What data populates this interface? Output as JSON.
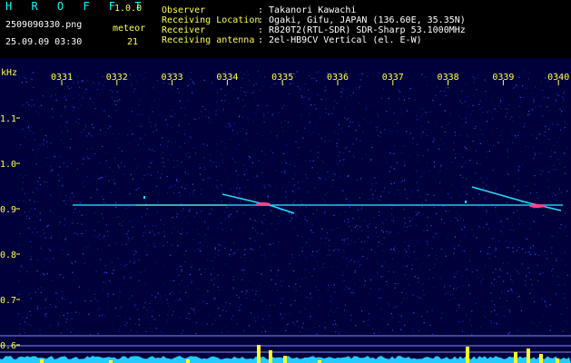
{
  "header": {
    "app_name": "H R O F F T",
    "version": "1.0.0",
    "filename": "2509090330.png",
    "meteor_label": "meteor",
    "meteor_count": "21",
    "datetime": "25.09.09 03:30",
    "info": [
      {
        "label": "Observer",
        "value": ": Takanori Kawachi"
      },
      {
        "label": "Receiving Location",
        "value": ": Ogaki, Gifu, JAPAN (136.60E, 35.35N)"
      },
      {
        "label": "Receiver",
        "value": ": R820T2(RTL-SDR) SDR-Sharp 53.1000MHz"
      },
      {
        "label": "Receiving antenna",
        "value": ": 2el-HB9CV Vertical (el. E-W)"
      }
    ]
  },
  "chart_data": {
    "type": "heatmap",
    "ylabel": "kHz",
    "y_ticks": [
      "1.1",
      "1.0",
      "0.9",
      "0.8",
      "0.7",
      "0.6"
    ],
    "x_ticks": [
      "0331",
      "0332",
      "0333",
      "0334",
      "0335",
      "0336",
      "0337",
      "0338",
      "0339",
      "0340"
    ],
    "colors": {
      "background": "#00003a",
      "trace": "#22ddff",
      "echo": "#ff4488",
      "tick": "#ffff44",
      "baseline": "#22ccff"
    }
  }
}
